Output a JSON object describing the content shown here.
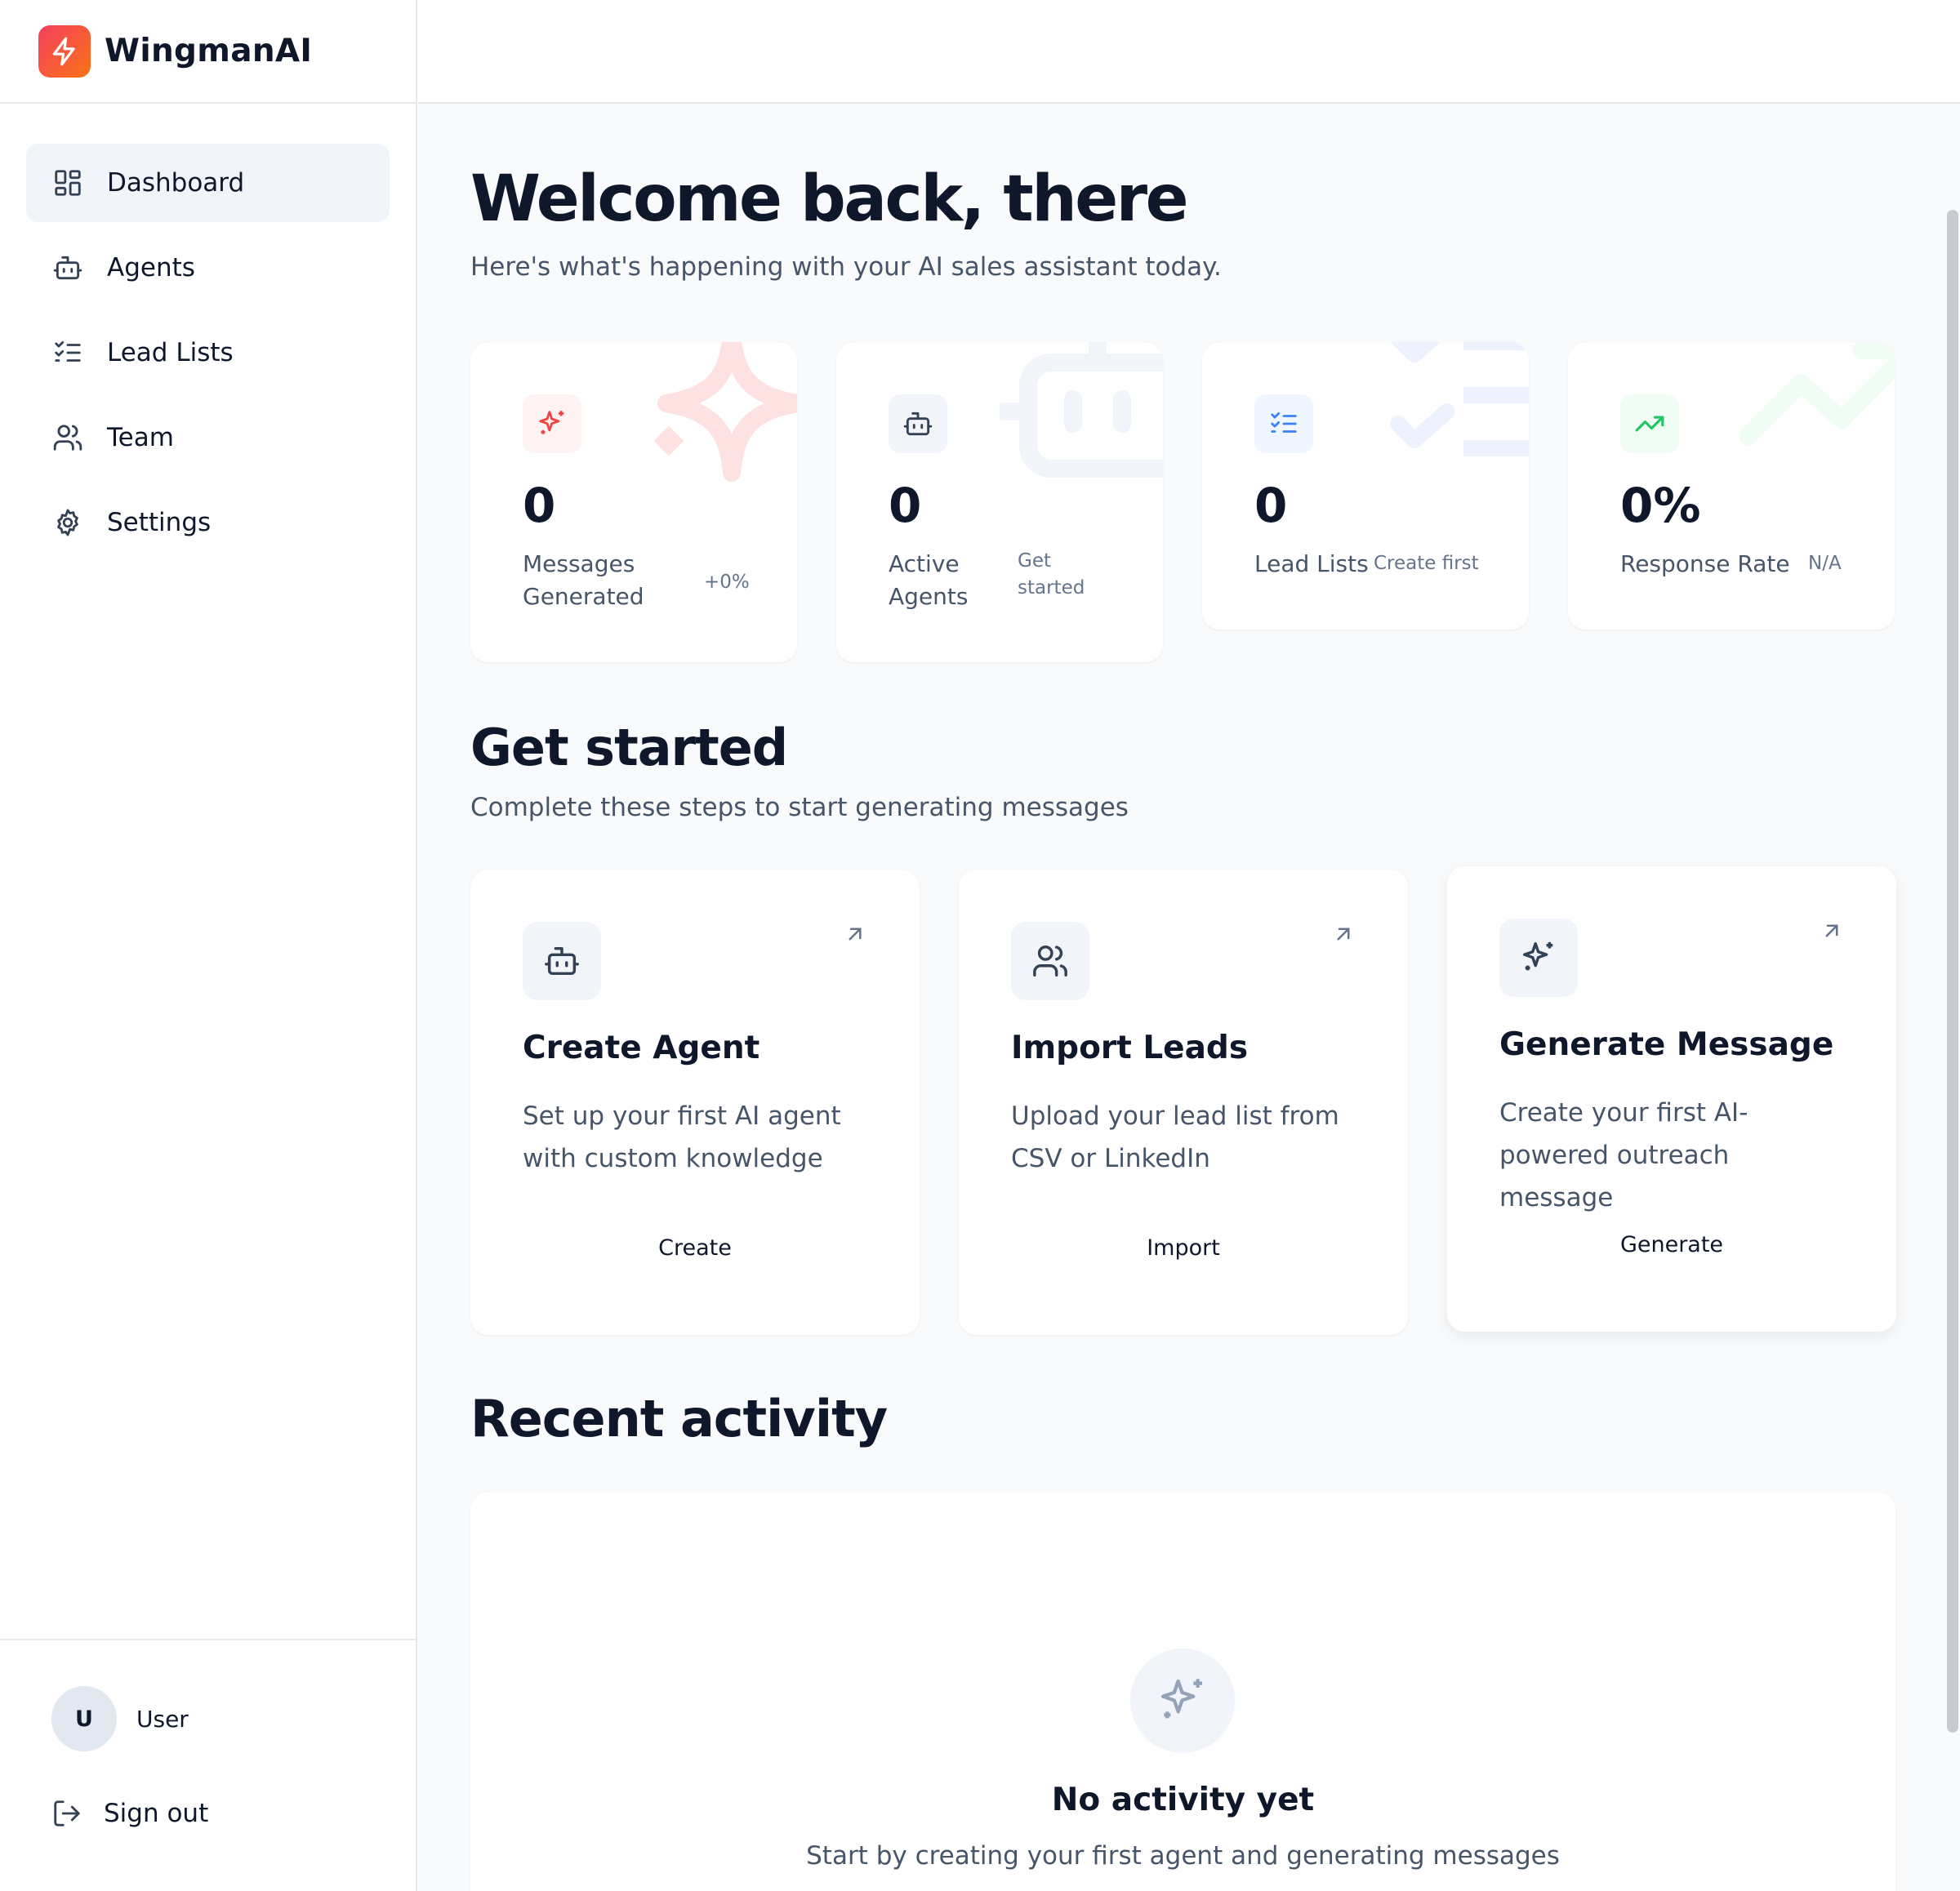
{
  "brand": {
    "name": "WingmanAI",
    "logo_icon": "lightning-icon",
    "accent": "#f43f5e"
  },
  "sidebar": {
    "items": [
      {
        "label": "Dashboard",
        "icon": "dashboard-icon",
        "active": true
      },
      {
        "label": "Agents",
        "icon": "bot-icon",
        "active": false
      },
      {
        "label": "Lead Lists",
        "icon": "checklist-icon",
        "active": false
      },
      {
        "label": "Team",
        "icon": "users-icon",
        "active": false
      },
      {
        "label": "Settings",
        "icon": "gear-icon",
        "active": false
      }
    ],
    "user": {
      "initial": "U",
      "name": "User"
    },
    "signout_label": "Sign out"
  },
  "header": {
    "title": "Welcome back, there",
    "subtitle": "Here's what's happening with your AI sales assistant today."
  },
  "stats": [
    {
      "value": "0",
      "label": "Messages Generated",
      "note": "+0%",
      "icon": "sparkle-icon",
      "color": "#ef4444"
    },
    {
      "value": "0",
      "label": "Active Agents",
      "note": "Get started",
      "icon": "bot-icon",
      "color": "#334155"
    },
    {
      "value": "0",
      "label": "Lead Lists",
      "note": "Create first",
      "icon": "checklist-icon",
      "color": "#3b82f6"
    },
    {
      "value": "0%",
      "label": "Response Rate",
      "note": "N/A",
      "icon": "trending-up-icon",
      "color": "#22c55e"
    }
  ],
  "get_started": {
    "title": "Get started",
    "subtitle": "Complete these steps to start generating messages",
    "steps": [
      {
        "title": "Create Agent",
        "description": "Set up your first AI agent with custom knowledge",
        "action": "Create",
        "icon": "bot-icon"
      },
      {
        "title": "Import Leads",
        "description": "Upload your lead list from CSV or LinkedIn",
        "action": "Import",
        "icon": "users-icon"
      },
      {
        "title": "Generate Message",
        "description": "Create your first AI-powered outreach message",
        "action": "Generate",
        "icon": "sparkle-icon"
      }
    ]
  },
  "recent_activity": {
    "title": "Recent activity",
    "empty_title": "No activity yet",
    "empty_subtitle": "Start by creating your first agent and generating messages"
  }
}
